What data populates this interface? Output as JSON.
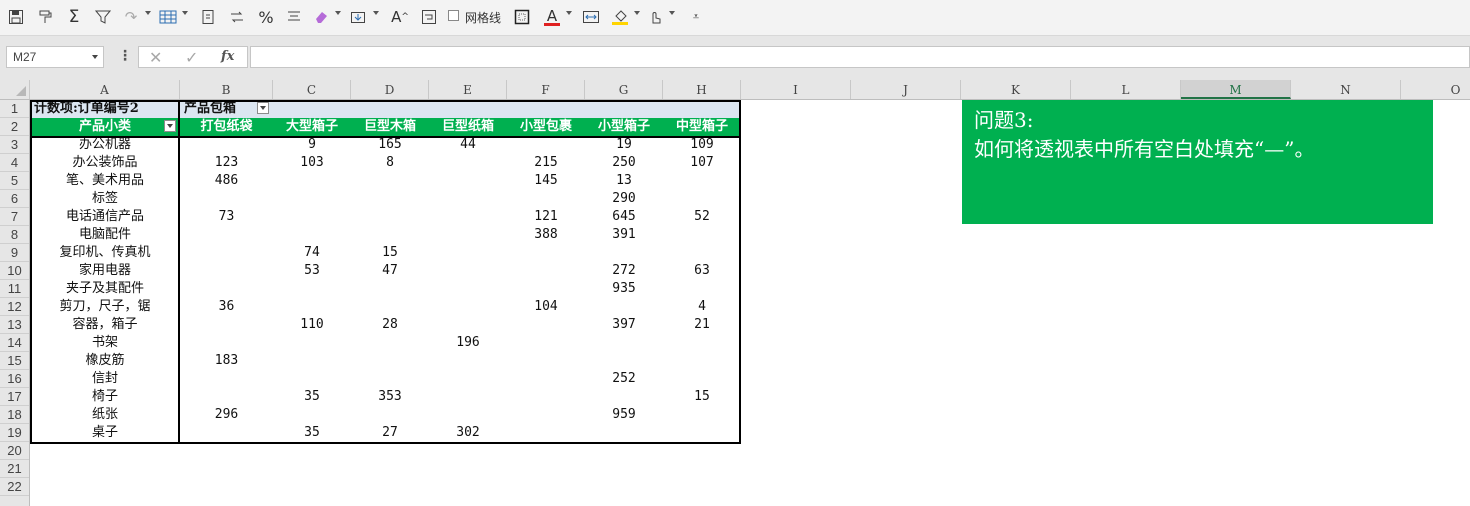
{
  "toolbar": {
    "icons": [
      "save-icon",
      "format-painter-icon",
      "sum-icon",
      "filter-icon",
      "redo-icon",
      "table-style-icon",
      "paste-values-icon",
      "switch-icon",
      "percent-icon",
      "align-icon",
      "eraser-icon",
      "insert-icon",
      "font-size-icon",
      "wrap-icon"
    ],
    "gridlines_label": "网格线",
    "font_color_letter": "A",
    "accent_red": "#e02020",
    "accent_yellow": "#ffd400"
  },
  "formula_bar": {
    "name_box": "M27",
    "fx": "fx",
    "formula": ""
  },
  "columns": [
    "A",
    "B",
    "C",
    "D",
    "E",
    "F",
    "G",
    "H",
    "I",
    "J",
    "K",
    "L",
    "M",
    "N",
    "O"
  ],
  "active_column": "M",
  "rows": [
    "1",
    "2",
    "3",
    "4",
    "5",
    "6",
    "7",
    "8",
    "9",
    "10",
    "11",
    "12",
    "13",
    "14",
    "15",
    "16",
    "17",
    "18",
    "19",
    "20",
    "21",
    "22"
  ],
  "pivot": {
    "header_row1": {
      "a": "计数项:订单编号2",
      "b": "产品包箱"
    },
    "header_row2": [
      "产品小类",
      "打包纸袋",
      "大型箱子",
      "巨型木箱",
      "巨型纸箱",
      "小型包裹",
      "小型箱子",
      "中型箱子"
    ],
    "body": [
      [
        "办公机器",
        "",
        "9",
        "165",
        "44",
        "",
        "19",
        "109"
      ],
      [
        "办公装饰品",
        "123",
        "103",
        "8",
        "",
        "215",
        "250",
        "107"
      ],
      [
        "笔、美术用品",
        "486",
        "",
        "",
        "",
        "145",
        "13",
        ""
      ],
      [
        "标签",
        "",
        "",
        "",
        "",
        "",
        "290",
        ""
      ],
      [
        "电话通信产品",
        "73",
        "",
        "",
        "",
        "121",
        "645",
        "52"
      ],
      [
        "电脑配件",
        "",
        "",
        "",
        "",
        "388",
        "391",
        ""
      ],
      [
        "复印机、传真机",
        "",
        "74",
        "15",
        "",
        "",
        "",
        ""
      ],
      [
        "家用电器",
        "",
        "53",
        "47",
        "",
        "",
        "272",
        "63"
      ],
      [
        "夹子及其配件",
        "",
        "",
        "",
        "",
        "",
        "935",
        ""
      ],
      [
        "剪刀，尺子，锯",
        "36",
        "",
        "",
        "",
        "104",
        "",
        "4"
      ],
      [
        "容器，箱子",
        "",
        "110",
        "28",
        "",
        "",
        "397",
        "21"
      ],
      [
        "书架",
        "",
        "",
        "",
        "196",
        "",
        "",
        ""
      ],
      [
        "橡皮筋",
        "183",
        "",
        "",
        "",
        "",
        "",
        ""
      ],
      [
        "信封",
        "",
        "",
        "",
        "",
        "",
        "252",
        ""
      ],
      [
        "椅子",
        "",
        "35",
        "353",
        "",
        "",
        "",
        "15"
      ],
      [
        "纸张",
        "296",
        "",
        "",
        "",
        "",
        "959",
        ""
      ],
      [
        "桌子",
        "",
        "35",
        "27",
        "302",
        "",
        "",
        ""
      ]
    ]
  },
  "question": {
    "line1": "问题3:",
    "line2": "如何将透视表中所有空白处填充“—”。"
  },
  "colors": {
    "header_blue": "#dce6f1",
    "header_green": "#00b050",
    "question_green": "#00b050"
  }
}
